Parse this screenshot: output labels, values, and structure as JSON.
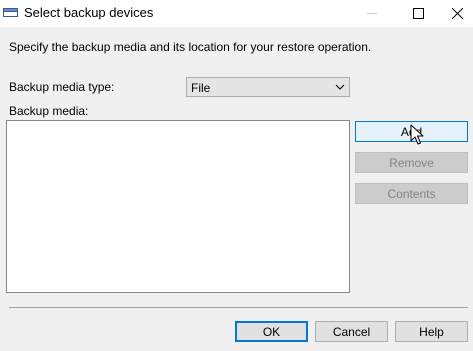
{
  "window": {
    "title": "Select backup devices",
    "icon": "dialog-window-icon"
  },
  "instructions": "Specify the backup media and its location for your restore operation.",
  "media_type": {
    "label": "Backup media type:",
    "selected": "File"
  },
  "media_list": {
    "label": "Backup media:",
    "items": []
  },
  "buttons": {
    "add": "Add",
    "remove": "Remove",
    "contents": "Contents",
    "ok": "OK",
    "cancel": "Cancel",
    "help": "Help"
  },
  "colors": {
    "background": "#f0f0f0",
    "accent": "#0078d7",
    "disabled_text": "#838383"
  }
}
